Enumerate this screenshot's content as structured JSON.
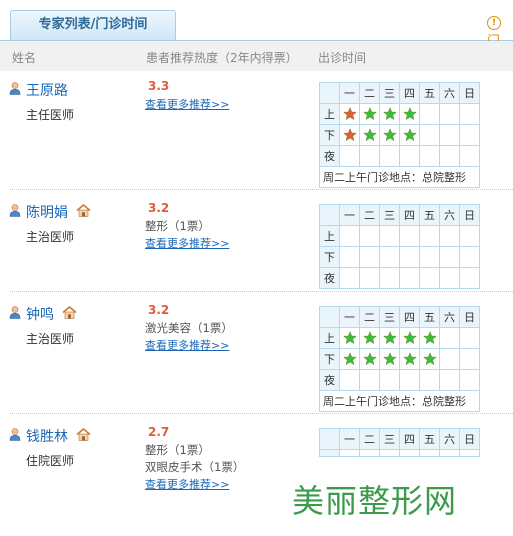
{
  "tab_title": "专家列表/门诊时间",
  "info_text": "门",
  "columns": {
    "name": "姓名",
    "heat": "患者推荐热度（2年内得票）",
    "schedule": "出诊时间"
  },
  "weekdays": [
    "一",
    "二",
    "三",
    "四",
    "五",
    "六",
    "日"
  ],
  "periods": [
    "上",
    "下",
    "夜"
  ],
  "more_link": "查看更多推荐>>",
  "colors": {
    "accent": "#1a67b8",
    "score": "#e15c3a",
    "star_green": "#3bbf3b",
    "star_red": "#e85a35",
    "watermark": "#3c9a4b"
  },
  "doctors": [
    {
      "name": "王原路",
      "title": "主任医师",
      "score": "3.3",
      "tags": [],
      "schedule": {
        "上": [
          "red",
          "green",
          "green",
          "green",
          "",
          "",
          ""
        ],
        "下": [
          "red",
          "green",
          "green",
          "green",
          "",
          "",
          ""
        ],
        "夜": [
          "",
          "",
          "",
          "",
          "",
          "",
          ""
        ]
      },
      "note": "周二上午门诊地点：总院整形"
    },
    {
      "name": "陈明娟",
      "title": "主治医师",
      "score": "3.2",
      "tags": [
        "整形（1票）"
      ],
      "schedule": {
        "上": [
          "",
          "",
          "",
          "",
          "",
          "",
          ""
        ],
        "下": [
          "",
          "",
          "",
          "",
          "",
          "",
          ""
        ],
        "夜": [
          "",
          "",
          "",
          "",
          "",
          "",
          ""
        ]
      },
      "note": ""
    },
    {
      "name": "钟鸣",
      "title": "主治医师",
      "score": "3.2",
      "tags": [
        "激光美容（1票）"
      ],
      "schedule": {
        "上": [
          "green",
          "green",
          "green",
          "green",
          "green",
          "",
          ""
        ],
        "下": [
          "green",
          "green",
          "green",
          "green",
          "green",
          "",
          ""
        ],
        "夜": [
          "",
          "",
          "",
          "",
          "",
          "",
          ""
        ]
      },
      "note": "周二上午门诊地点：总院整形"
    },
    {
      "name": "钱胜林",
      "title": "住院医师",
      "score": "2.7",
      "tags": [
        "整形（1票）",
        "双眼皮手术（1票）"
      ],
      "schedule": null,
      "note": ""
    }
  ],
  "watermark": "美丽整形网"
}
